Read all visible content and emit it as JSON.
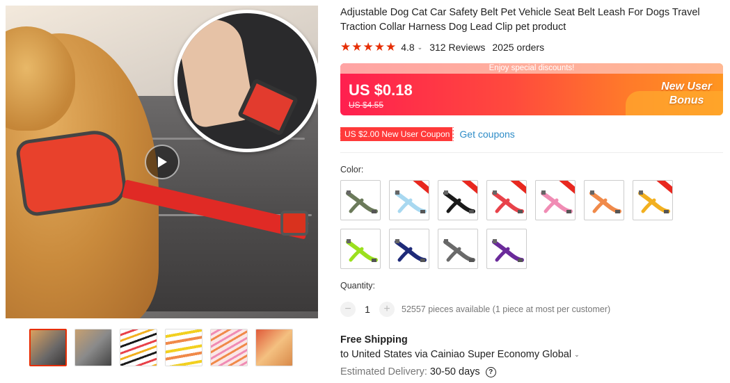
{
  "product": {
    "title": "Adjustable Dog Cat Car Safety Belt Pet Vehicle Seat Belt Leash For Dogs Travel Traction Collar Harness Dog Lead Clip pet product",
    "rating": "4.8",
    "stars": "★★★★★",
    "reviews": "312 Reviews",
    "orders": "2025 orders"
  },
  "price": {
    "banner_note": "Enjoy special discounts!",
    "current": "US $0.18",
    "original": "US $4.55",
    "bonus_line1": "New User",
    "bonus_line2": "Bonus"
  },
  "coupon": {
    "tag": "US $2.00 New User Coupon",
    "link": "Get coupons"
  },
  "color": {
    "label": "Color:",
    "swatches": [
      {
        "name": "army-green",
        "color": "#6b7a5a",
        "sale": false
      },
      {
        "name": "light-blue",
        "color": "#a8d8f0",
        "sale": true
      },
      {
        "name": "black",
        "color": "#1a1a1a",
        "sale": true
      },
      {
        "name": "red",
        "color": "#e8424a",
        "sale": true
      },
      {
        "name": "pink",
        "color": "#f08cb4",
        "sale": true
      },
      {
        "name": "orange",
        "color": "#f08a4a",
        "sale": false
      },
      {
        "name": "yellow",
        "color": "#f2b020",
        "sale": true
      },
      {
        "name": "lime",
        "color": "#9be01e",
        "sale": false
      },
      {
        "name": "navy",
        "color": "#1e2a78",
        "sale": false
      },
      {
        "name": "grey",
        "color": "#6a6a6a",
        "sale": false
      },
      {
        "name": "purple",
        "color": "#6a2a9a",
        "sale": false
      }
    ]
  },
  "quantity": {
    "label": "Quantity:",
    "minus": "−",
    "value": "1",
    "plus": "+",
    "available": "52557 pieces available (1 piece at most per customer)"
  },
  "shipping": {
    "title": "Free Shipping",
    "destination": "to United States via Cainiao Super Economy Global",
    "delivery_label": "Estimated Delivery:",
    "delivery_value": "30-50 days",
    "help": "?"
  },
  "icons": {
    "chevron": "⌄"
  }
}
